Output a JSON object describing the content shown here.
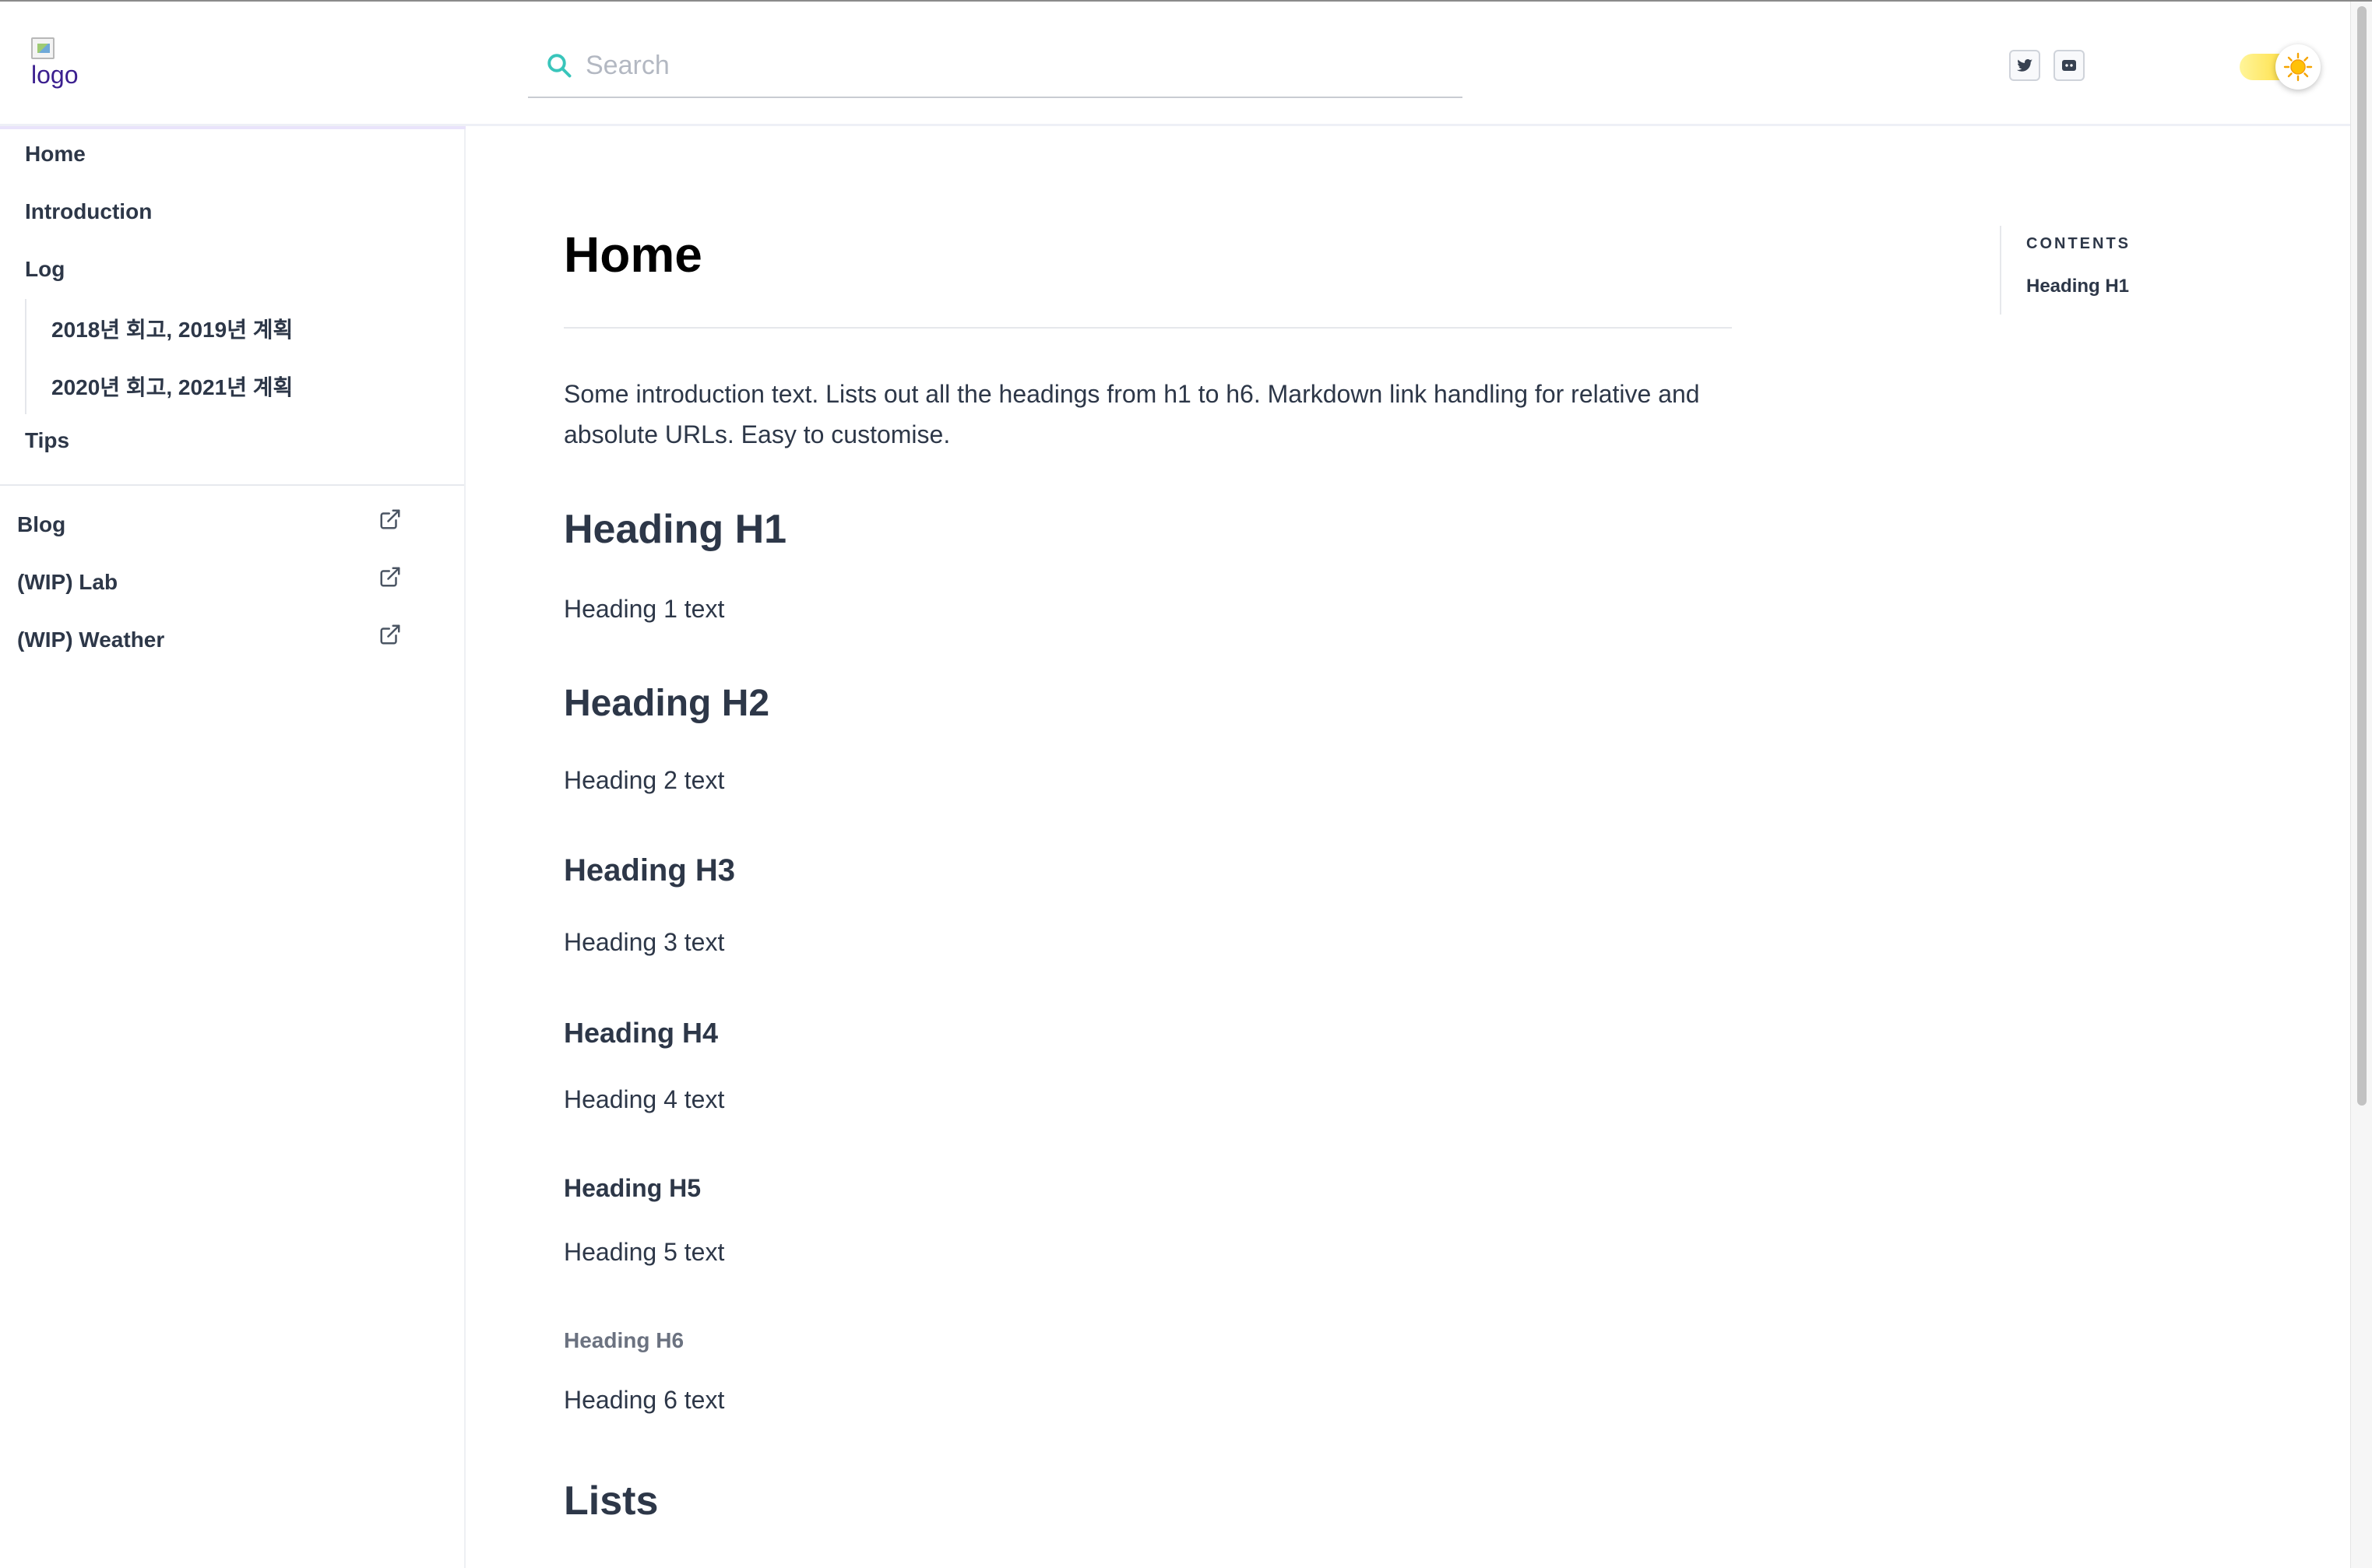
{
  "header": {
    "logo_alt": "logo",
    "search_placeholder": "Search",
    "social": [
      "twitter-icon",
      "discord-icon"
    ],
    "theme_toggle_icon": "sun-icon",
    "accent": "#39c5bb"
  },
  "sidebar": {
    "items": [
      {
        "label": "Home"
      },
      {
        "label": "Introduction"
      },
      {
        "label": "Log"
      },
      {
        "label": "2018년 회고, 2019년 계획"
      },
      {
        "label": "2020년 회고, 2021년 계획"
      },
      {
        "label": "Tips"
      }
    ],
    "external": [
      {
        "label": "Blog",
        "icon": "external-link-icon"
      },
      {
        "label": "(WIP) Lab",
        "icon": "external-link-icon"
      },
      {
        "label": "(WIP) Weather",
        "icon": "external-link-icon"
      }
    ]
  },
  "main": {
    "title": "Home",
    "intro": "Some introduction text. Lists out all the headings from h1 to h6. Markdown link handling for relative and absolute URLs. Easy to customise.",
    "sections": [
      {
        "heading": "Heading H1",
        "text": "Heading 1 text"
      },
      {
        "heading": "Heading H2",
        "text": "Heading 2 text"
      },
      {
        "heading": "Heading H3",
        "text": "Heading 3 text"
      },
      {
        "heading": "Heading H4",
        "text": "Heading 4 text"
      },
      {
        "heading": "Heading H5",
        "text": "Heading 5 text"
      },
      {
        "heading": "Heading H6",
        "text": "Heading 6 text"
      }
    ],
    "next_heading": "Lists"
  },
  "toc": {
    "title": "CONTENTS",
    "items": [
      "Heading H1"
    ]
  }
}
